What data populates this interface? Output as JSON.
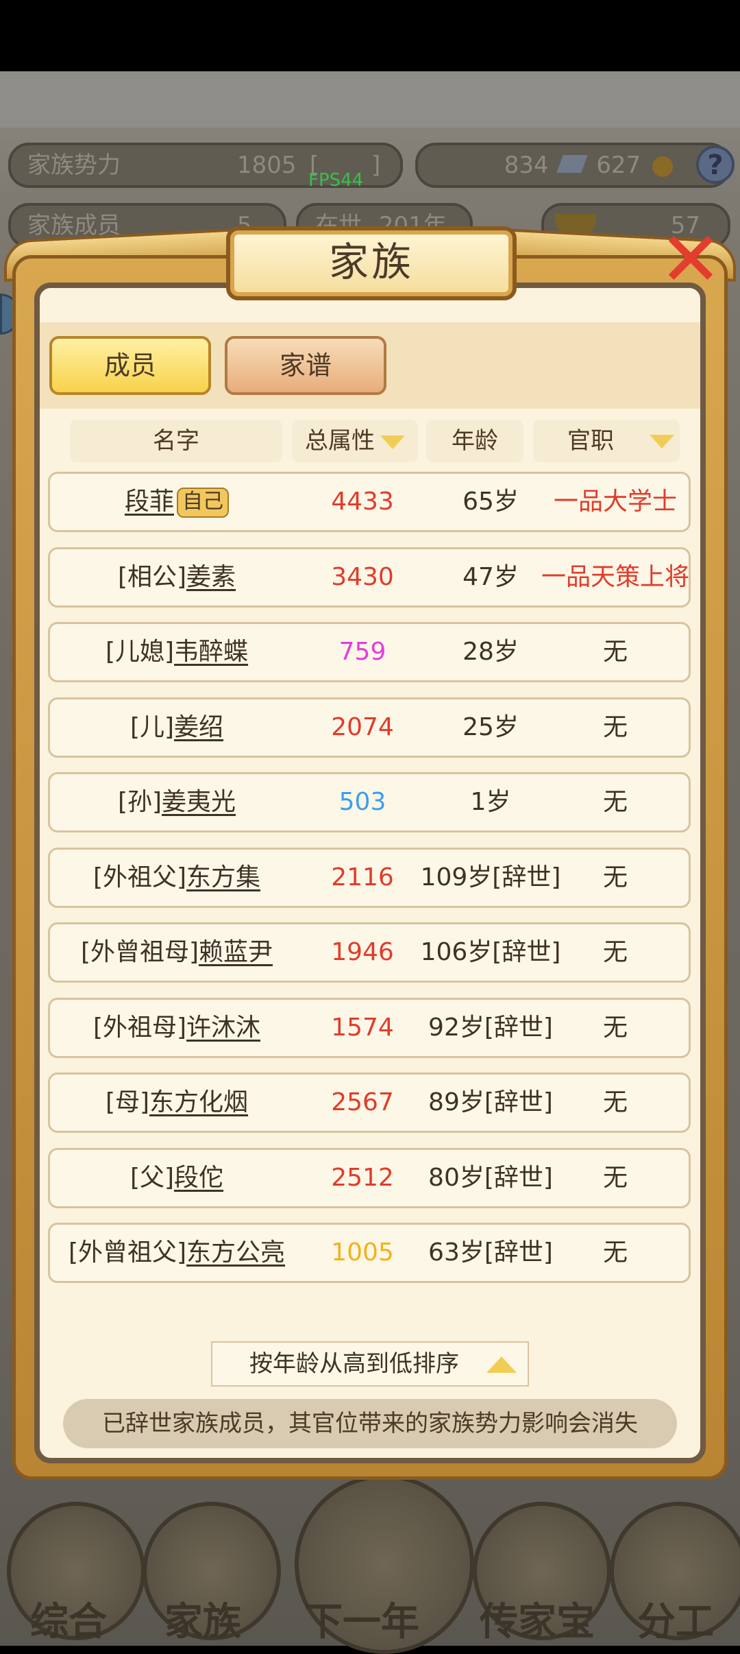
{
  "hud": {
    "family_power_label": "家族势力",
    "family_power_value": "1805",
    "family_power_extra": "[",
    "family_power_close": "]",
    "currency_a": "834",
    "currency_b": "627",
    "family_members_label": "家族成员",
    "family_members_value": "5",
    "year_label": "在世",
    "year_value": "201年",
    "gold_value": "57",
    "help": "?"
  },
  "fps": "FPS44",
  "modal": {
    "title": "家族"
  },
  "tabs": {
    "members": "成员",
    "tree": "家谱"
  },
  "table": {
    "headers": {
      "name": "名字",
      "attr": "总属性",
      "age": "年龄",
      "office": "官职"
    },
    "rows": [
      {
        "prefix": "",
        "name": "段菲",
        "badge": "自己",
        "attr": "4433",
        "attr_color": "#e23b2b",
        "age": "65岁",
        "office": "一品大学士",
        "office_color": "#e23b2b"
      },
      {
        "prefix": "[相公]",
        "name": "姜素",
        "badge": "",
        "attr": "3430",
        "attr_color": "#e23b2b",
        "age": "47岁",
        "office": "一品天策上将",
        "office_color": "#e23b2b"
      },
      {
        "prefix": "[儿媳]",
        "name": "韦醉蝶",
        "badge": "",
        "attr": "759",
        "attr_color": "#e33be0",
        "age": "28岁",
        "office": "无",
        "office_color": "#3e3226"
      },
      {
        "prefix": "[儿]",
        "name": "姜绍",
        "badge": "",
        "attr": "2074",
        "attr_color": "#e23b2b",
        "age": "25岁",
        "office": "无",
        "office_color": "#3e3226"
      },
      {
        "prefix": "[孙]",
        "name": "姜夷光",
        "badge": "",
        "attr": "503",
        "attr_color": "#3a9ef0",
        "age": "1岁",
        "office": "无",
        "office_color": "#3e3226"
      },
      {
        "prefix": "[外祖父]",
        "name": "东方集",
        "badge": "",
        "attr": "2116",
        "attr_color": "#e23b2b",
        "age": "109岁[辞世]",
        "office": "无",
        "office_color": "#3e3226"
      },
      {
        "prefix": "[外曾祖母]",
        "name": "赖蓝尹",
        "badge": "",
        "attr": "1946",
        "attr_color": "#e23b2b",
        "age": "106岁[辞世]",
        "office": "无",
        "office_color": "#3e3226"
      },
      {
        "prefix": "[外祖母]",
        "name": "许沐沐",
        "badge": "",
        "attr": "1574",
        "attr_color": "#e23b2b",
        "age": "92岁[辞世]",
        "office": "无",
        "office_color": "#3e3226"
      },
      {
        "prefix": "[母]",
        "name": "东方化烟",
        "badge": "",
        "attr": "2567",
        "attr_color": "#e23b2b",
        "age": "89岁[辞世]",
        "office": "无",
        "office_color": "#3e3226"
      },
      {
        "prefix": "[父]",
        "name": "段佗",
        "badge": "",
        "attr": "2512",
        "attr_color": "#e23b2b",
        "age": "80岁[辞世]",
        "office": "无",
        "office_color": "#3e3226"
      },
      {
        "prefix": "[外曾祖父]",
        "name": "东方公亮",
        "badge": "",
        "attr": "1005",
        "attr_color": "#f2b21b",
        "age": "63岁[辞世]",
        "office": "无",
        "office_color": "#3e3226"
      }
    ]
  },
  "sort_button": "按年龄从高到低排序",
  "notice": "已辞世家族成员，其官位带来的家族势力影响会消失",
  "bottom_nav": [
    {
      "label": "综合"
    },
    {
      "label": "家族"
    },
    {
      "label": "下一年"
    },
    {
      "label": "传家宝"
    },
    {
      "label": "分工"
    }
  ]
}
